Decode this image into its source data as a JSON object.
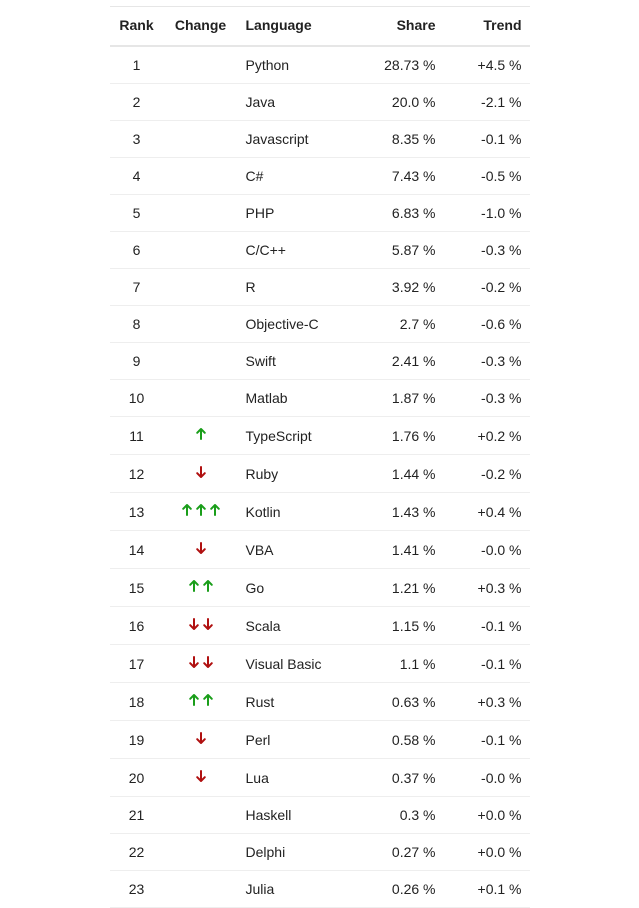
{
  "headers": {
    "rank": "Rank",
    "change": "Change",
    "language": "Language",
    "share": "Share",
    "trend": "Trend"
  },
  "rows": [
    {
      "rank": "1",
      "change": 0,
      "language": "Python",
      "share": "28.73 %",
      "trend": "+4.5 %"
    },
    {
      "rank": "2",
      "change": 0,
      "language": "Java",
      "share": "20.0 %",
      "trend": "-2.1 %"
    },
    {
      "rank": "3",
      "change": 0,
      "language": "Javascript",
      "share": "8.35 %",
      "trend": "-0.1 %"
    },
    {
      "rank": "4",
      "change": 0,
      "language": "C#",
      "share": "7.43 %",
      "trend": "-0.5 %"
    },
    {
      "rank": "5",
      "change": 0,
      "language": "PHP",
      "share": "6.83 %",
      "trend": "-1.0 %"
    },
    {
      "rank": "6",
      "change": 0,
      "language": "C/C++",
      "share": "5.87 %",
      "trend": "-0.3 %"
    },
    {
      "rank": "7",
      "change": 0,
      "language": "R",
      "share": "3.92 %",
      "trend": "-0.2 %"
    },
    {
      "rank": "8",
      "change": 0,
      "language": "Objective-C",
      "share": "2.7 %",
      "trend": "-0.6 %"
    },
    {
      "rank": "9",
      "change": 0,
      "language": "Swift",
      "share": "2.41 %",
      "trend": "-0.3 %"
    },
    {
      "rank": "10",
      "change": 0,
      "language": "Matlab",
      "share": "1.87 %",
      "trend": "-0.3 %"
    },
    {
      "rank": "11",
      "change": 1,
      "language": "TypeScript",
      "share": "1.76 %",
      "trend": "+0.2 %"
    },
    {
      "rank": "12",
      "change": -1,
      "language": "Ruby",
      "share": "1.44 %",
      "trend": "-0.2 %"
    },
    {
      "rank": "13",
      "change": 3,
      "language": "Kotlin",
      "share": "1.43 %",
      "trend": "+0.4 %"
    },
    {
      "rank": "14",
      "change": -1,
      "language": "VBA",
      "share": "1.41 %",
      "trend": "-0.0 %"
    },
    {
      "rank": "15",
      "change": 2,
      "language": "Go",
      "share": "1.21 %",
      "trend": "+0.3 %"
    },
    {
      "rank": "16",
      "change": -2,
      "language": "Scala",
      "share": "1.15 %",
      "trend": "-0.1 %"
    },
    {
      "rank": "17",
      "change": -2,
      "language": "Visual Basic",
      "share": "1.1 %",
      "trend": "-0.1 %"
    },
    {
      "rank": "18",
      "change": 2,
      "language": "Rust",
      "share": "0.63 %",
      "trend": "+0.3 %"
    },
    {
      "rank": "19",
      "change": -1,
      "language": "Perl",
      "share": "0.58 %",
      "trend": "-0.1 %"
    },
    {
      "rank": "20",
      "change": -1,
      "language": "Lua",
      "share": "0.37 %",
      "trend": "-0.0 %"
    },
    {
      "rank": "21",
      "change": 0,
      "language": "Haskell",
      "share": "0.3 %",
      "trend": "+0.0 %"
    },
    {
      "rank": "22",
      "change": 0,
      "language": "Delphi",
      "share": "0.27 %",
      "trend": "+0.0 %"
    },
    {
      "rank": "23",
      "change": 0,
      "language": "Julia",
      "share": "0.26 %",
      "trend": "+0.1 %"
    }
  ],
  "chart_data": {
    "type": "table",
    "title": "Programming language popularity ranking",
    "columns": [
      "Rank",
      "Change",
      "Language",
      "Share",
      "Trend"
    ],
    "series": [
      {
        "name": "Python",
        "rank": 1,
        "rank_change": 0,
        "share_pct": 28.73,
        "trend_pct": 4.5
      },
      {
        "name": "Java",
        "rank": 2,
        "rank_change": 0,
        "share_pct": 20.0,
        "trend_pct": -2.1
      },
      {
        "name": "Javascript",
        "rank": 3,
        "rank_change": 0,
        "share_pct": 8.35,
        "trend_pct": -0.1
      },
      {
        "name": "C#",
        "rank": 4,
        "rank_change": 0,
        "share_pct": 7.43,
        "trend_pct": -0.5
      },
      {
        "name": "PHP",
        "rank": 5,
        "rank_change": 0,
        "share_pct": 6.83,
        "trend_pct": -1.0
      },
      {
        "name": "C/C++",
        "rank": 6,
        "rank_change": 0,
        "share_pct": 5.87,
        "trend_pct": -0.3
      },
      {
        "name": "R",
        "rank": 7,
        "rank_change": 0,
        "share_pct": 3.92,
        "trend_pct": -0.2
      },
      {
        "name": "Objective-C",
        "rank": 8,
        "rank_change": 0,
        "share_pct": 2.7,
        "trend_pct": -0.6
      },
      {
        "name": "Swift",
        "rank": 9,
        "rank_change": 0,
        "share_pct": 2.41,
        "trend_pct": -0.3
      },
      {
        "name": "Matlab",
        "rank": 10,
        "rank_change": 0,
        "share_pct": 1.87,
        "trend_pct": -0.3
      },
      {
        "name": "TypeScript",
        "rank": 11,
        "rank_change": 1,
        "share_pct": 1.76,
        "trend_pct": 0.2
      },
      {
        "name": "Ruby",
        "rank": 12,
        "rank_change": -1,
        "share_pct": 1.44,
        "trend_pct": -0.2
      },
      {
        "name": "Kotlin",
        "rank": 13,
        "rank_change": 3,
        "share_pct": 1.43,
        "trend_pct": 0.4
      },
      {
        "name": "VBA",
        "rank": 14,
        "rank_change": -1,
        "share_pct": 1.41,
        "trend_pct": 0.0
      },
      {
        "name": "Go",
        "rank": 15,
        "rank_change": 2,
        "share_pct": 1.21,
        "trend_pct": 0.3
      },
      {
        "name": "Scala",
        "rank": 16,
        "rank_change": -2,
        "share_pct": 1.15,
        "trend_pct": -0.1
      },
      {
        "name": "Visual Basic",
        "rank": 17,
        "rank_change": -2,
        "share_pct": 1.1,
        "trend_pct": -0.1
      },
      {
        "name": "Rust",
        "rank": 18,
        "rank_change": 2,
        "share_pct": 0.63,
        "trend_pct": 0.3
      },
      {
        "name": "Perl",
        "rank": 19,
        "rank_change": -1,
        "share_pct": 0.58,
        "trend_pct": -0.1
      },
      {
        "name": "Lua",
        "rank": 20,
        "rank_change": -1,
        "share_pct": 0.37,
        "trend_pct": 0.0
      },
      {
        "name": "Haskell",
        "rank": 21,
        "rank_change": 0,
        "share_pct": 0.3,
        "trend_pct": 0.0
      },
      {
        "name": "Delphi",
        "rank": 22,
        "rank_change": 0,
        "share_pct": 0.27,
        "trend_pct": 0.0
      },
      {
        "name": "Julia",
        "rank": 23,
        "rank_change": 0,
        "share_pct": 0.26,
        "trend_pct": 0.1
      }
    ]
  }
}
